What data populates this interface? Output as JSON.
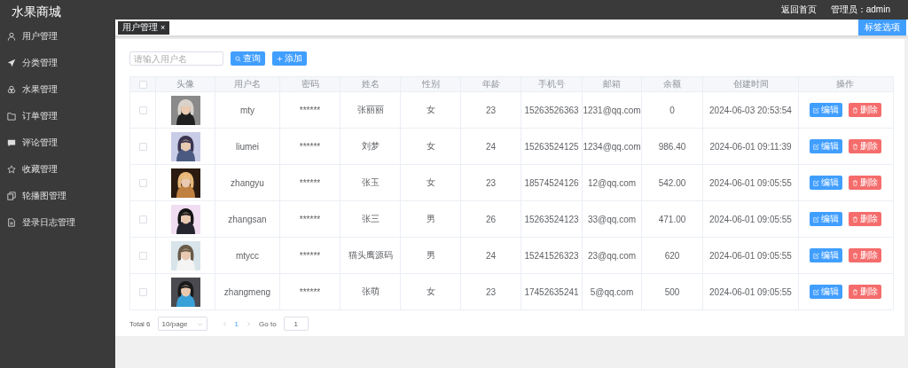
{
  "header": {
    "title": "水果商城",
    "home_link": "返回首页",
    "admin": "管理员：admin"
  },
  "sidebar": {
    "items": [
      {
        "label": "用户管理"
      },
      {
        "label": "分类管理"
      },
      {
        "label": "水果管理"
      },
      {
        "label": "订单管理"
      },
      {
        "label": "评论管理"
      },
      {
        "label": "收藏管理"
      },
      {
        "label": "轮播图管理"
      },
      {
        "label": "登录日志管理"
      }
    ]
  },
  "tags": [
    {
      "label": "用户管理",
      "close": "×",
      "selected": true
    }
  ],
  "tag_options_button": "标签选项",
  "search": {
    "placeholder": "请输入用户名",
    "search_button": "查询",
    "add_button": "添加"
  },
  "table": {
    "all_checked": false,
    "columns": [
      "头像",
      "用户名",
      "密码",
      "姓名",
      "性别",
      "年龄",
      "手机号",
      "邮箱",
      "余额",
      "创建时间",
      "操作"
    ],
    "rows": [
      {
        "checked": false,
        "username": "mty",
        "password": "******",
        "name": "张丽丽",
        "gender": "女",
        "age": "23",
        "phone": "15263526363",
        "email": "1231@qq.com",
        "balance": "0",
        "created": "2024-06-03 20:53:54",
        "edit": "编辑",
        "delete": "删除"
      },
      {
        "checked": false,
        "username": "liumei",
        "password": "******",
        "name": "刘梦",
        "gender": "女",
        "age": "24",
        "phone": "15263524125",
        "email": "1234@qq.com",
        "balance": "986.40",
        "created": "2024-06-01 09:11:39",
        "edit": "编辑",
        "delete": "删除"
      },
      {
        "checked": false,
        "username": "zhangyu",
        "password": "******",
        "name": "张玉",
        "gender": "女",
        "age": "23",
        "phone": "18574524126",
        "email": "12@qq.com",
        "balance": "542.00",
        "created": "2024-06-01 09:05:55",
        "edit": "编辑",
        "delete": "删除"
      },
      {
        "checked": false,
        "username": "zhangsan",
        "password": "******",
        "name": "张三",
        "gender": "男",
        "age": "26",
        "phone": "15263524123",
        "email": "33@qq.com",
        "balance": "471.00",
        "created": "2024-06-01 09:05:55",
        "edit": "编辑",
        "delete": "删除"
      },
      {
        "checked": false,
        "username": "mtycc",
        "password": "******",
        "name": "猫头鹰源码",
        "gender": "男",
        "age": "24",
        "phone": "15241526323",
        "email": "23@qq.com",
        "balance": "620",
        "created": "2024-06-01 09:05:55",
        "edit": "编辑",
        "delete": "删除"
      },
      {
        "checked": false,
        "username": "zhangmeng",
        "password": "******",
        "name": "张萌",
        "gender": "女",
        "age": "23",
        "phone": "17452635241",
        "email": "5@qq.com",
        "balance": "500",
        "created": "2024-06-01 09:05:55",
        "edit": "编辑",
        "delete": "删除"
      }
    ]
  },
  "pagination": {
    "total": "Total 6",
    "page_size": "10/page",
    "pages": [
      {
        "label": "1",
        "selected": true
      }
    ],
    "goto_label": "Go to",
    "goto_value": "1"
  }
}
